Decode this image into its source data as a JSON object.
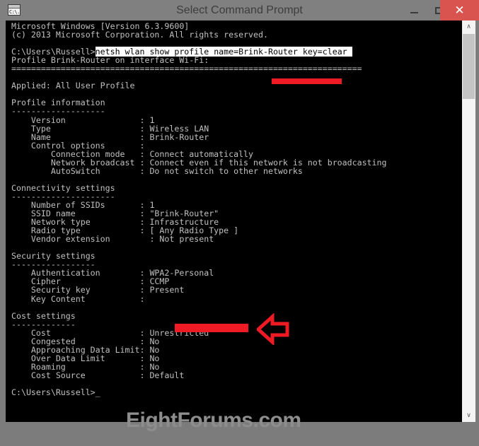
{
  "window": {
    "title": "Select Command Prompt",
    "icon_name": "command-prompt-icon",
    "icon_text": "C:\\.",
    "minimize_label": "—",
    "maximize_label": "□",
    "close_label": "✕"
  },
  "scrollbar": {
    "up_arrow": "∧",
    "down_arrow": "∨"
  },
  "console": {
    "header_line_1": "Microsoft Windows [Version 6.3.9600]",
    "header_line_2": "(c) 2013 Microsoft Corporation. All rights reserved.",
    "prompt": "C:\\Users\\Russell>",
    "command": "netsh wlan show profile name=Brink-Router key=clear",
    "profile_header": "Profile Brink-Router on interface Wi-Fi:",
    "separator": "=======================================================================",
    "applied": "Applied: All User Profile",
    "sections": [
      {
        "title": "Profile information",
        "underline": "-------------------",
        "rows": [
          {
            "label": "    Version",
            "sep": ": ",
            "value": "1"
          },
          {
            "label": "    Type",
            "sep": ": ",
            "value": "Wireless LAN"
          },
          {
            "label": "    Name",
            "sep": ": ",
            "value": "Brink-Router"
          },
          {
            "label": "    Control options",
            "sep": ": ",
            "value": ""
          },
          {
            "label": "        Connection mode",
            "sep": ": ",
            "value": "Connect automatically"
          },
          {
            "label": "        Network broadcast",
            "sep": ": ",
            "value": "Connect even if this network is not broadcasting"
          },
          {
            "label": "        AutoSwitch",
            "sep": ": ",
            "value": "Do not switch to other networks"
          }
        ]
      },
      {
        "title": "Connectivity settings",
        "underline": "---------------------",
        "rows": [
          {
            "label": "    Number of SSIDs",
            "sep": ": ",
            "value": "1"
          },
          {
            "label": "    SSID name",
            "sep": ": ",
            "value": "\"Brink-Router\""
          },
          {
            "label": "    Network type",
            "sep": ": ",
            "value": "Infrastructure"
          },
          {
            "label": "    Radio type",
            "sep": ": ",
            "value": "[ Any Radio Type ]"
          },
          {
            "label": "    Vendor extension",
            "sep": "  : ",
            "value": "Not present"
          }
        ]
      },
      {
        "title": "Security settings",
        "underline": "-----------------",
        "rows": [
          {
            "label": "    Authentication",
            "sep": ": ",
            "value": "WPA2-Personal"
          },
          {
            "label": "    Cipher",
            "sep": ": ",
            "value": "CCMP"
          },
          {
            "label": "    Security key",
            "sep": ": ",
            "value": "Present"
          },
          {
            "label": "    Key Content",
            "sep": ": ",
            "value": ""
          }
        ]
      },
      {
        "title": "Cost settings",
        "underline": "-------------",
        "rows": [
          {
            "label": "    Cost",
            "sep": ": ",
            "value": "Unrestricted"
          },
          {
            "label": "    Congested",
            "sep": ": ",
            "value": "No"
          },
          {
            "label": "    Approaching Data Limit",
            "sep": ": ",
            "value": "No"
          },
          {
            "label": "    Over Data Limit",
            "sep": ": ",
            "value": "No"
          },
          {
            "label": "    Roaming",
            "sep": ": ",
            "value": "No"
          },
          {
            "label": "    Cost Source",
            "sep": ": ",
            "value": "Default"
          }
        ]
      }
    ],
    "final_prompt": "C:\\Users\\Russell>",
    "cursor": "_"
  },
  "annotations": {
    "color": "#ee1b24",
    "underline_name": "red-underline-brink-router",
    "redaction_name": "red-redaction-key-content",
    "arrow_name": "red-left-arrow"
  },
  "watermark": {
    "text": "EightForums.com"
  }
}
